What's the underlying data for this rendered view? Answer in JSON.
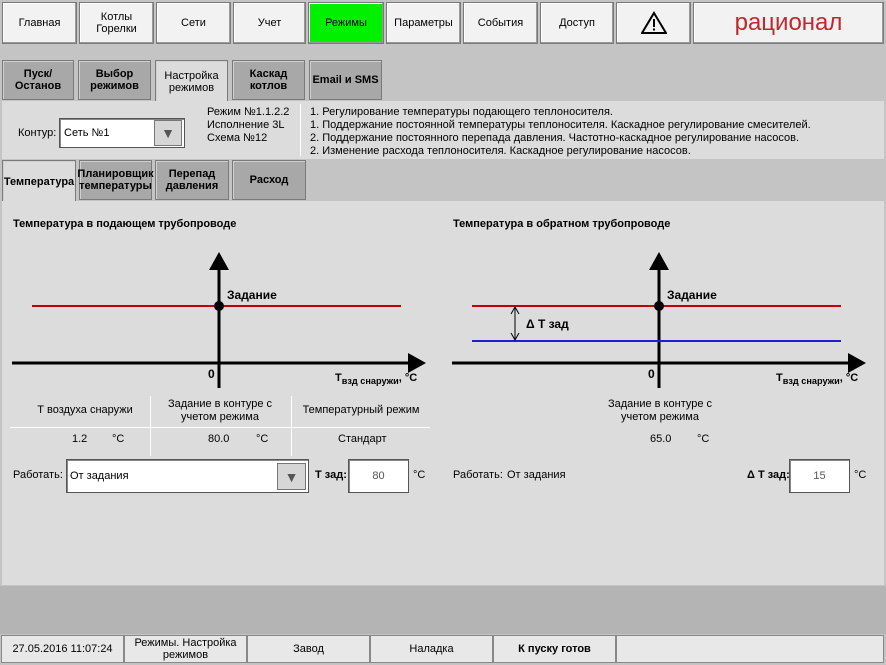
{
  "nav": {
    "items": [
      "Главная",
      "Котлы\nГорелки",
      "Сети",
      "Учет",
      "Режимы",
      "Параметры",
      "События",
      "Доступ"
    ],
    "active_index": 4,
    "brand": "рационал",
    "colors": {
      "active": "#00f000",
      "brand": "#c0282d"
    }
  },
  "tabs_top": [
    "Пуск/Останов",
    "Выбор режимов",
    "Настройка режимов",
    "Каскад котлов",
    "Email и SMS"
  ],
  "tabs_top_selected": 2,
  "contour": {
    "label": "Контур:",
    "value": "Сеть №1",
    "mode_lines": [
      "Режим №1.1.2.2",
      "Исполнение 3L",
      "Схема №12"
    ],
    "description": [
      "1. Регулирование температуры подающего теплоносителя.",
      "1. Поддержание постоянной температуры теплоносителя. Каскадное регулирование смесителей.",
      "2. Поддержание постоянного перепада давления. Частотно-каскадное регулирование насосов.",
      "2. Изменение расхода теплоносителя. Каскадное регулирование насосов."
    ]
  },
  "tabs_sub": [
    "Температура",
    "Планировщик температуры",
    "Перепад давления",
    "Расход"
  ],
  "tabs_sub_selected": 0,
  "left": {
    "title": "Температура в подающем трубопроводе",
    "setpoint_label": "Задание",
    "zero_label": "0",
    "axis_label_main": "Т",
    "axis_label_sub": "взд снаружи",
    "axis_label_unit": ", °С",
    "col_headers": [
      "Т воздуха снаружи",
      "Задание в контуре с учетом режима",
      "Температурный режим"
    ],
    "outdoor_temp": "1.2",
    "outdoor_unit": "°С",
    "setpoint_value": "80.0",
    "setpoint_unit": "°С",
    "temp_mode": "Стандарт",
    "work_label": "Работать:",
    "work_value": "От задания",
    "tset_label": "Т зад:",
    "tset_value": "80",
    "tset_unit": "°С"
  },
  "right": {
    "title": "Температура в обратном трубопроводе",
    "setpoint_label": "Задание",
    "delta_label": "Δ Т зад",
    "zero_label": "0",
    "axis_label_main": "Т",
    "axis_label_sub": "взд снаружи",
    "axis_label_unit": ", °С",
    "col_header": "Задание в контуре с учетом режима",
    "setpoint_value": "65.0",
    "setpoint_unit": "°С",
    "work_label": "Работать:",
    "work_value": "От задания",
    "dt_label": "Δ Т зад:",
    "dt_value": "15",
    "dt_unit": "°С"
  },
  "status": [
    "27.05.2016 11:07:24",
    "Режимы. Настройка режимов",
    "Завод",
    "Наладка",
    "К пуску готов",
    ""
  ]
}
